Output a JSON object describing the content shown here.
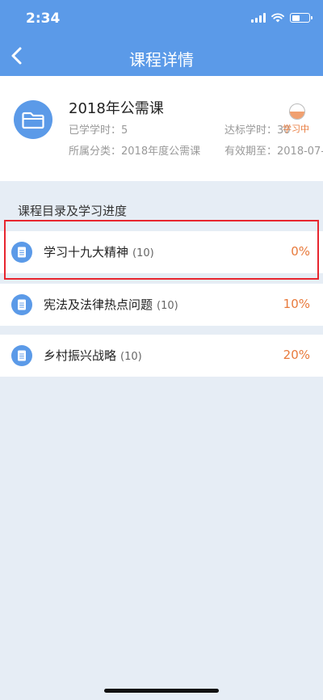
{
  "status_bar": {
    "time": "2:34"
  },
  "nav": {
    "title": "课程详情"
  },
  "course": {
    "name": "2018年公需课",
    "learned_hours": "已学学时：5",
    "target_hours": "达标学时：30",
    "category": "所属分类：2018年度公需课",
    "valid_until": "有效期至：2018-07-",
    "status": "学习中"
  },
  "catalog": {
    "title": "课程目录及学习进度",
    "items": [
      {
        "title": "学习十九大精神",
        "count": "(10)",
        "progress": "0%"
      },
      {
        "title": "宪法及法律热点问题",
        "count": "(10)",
        "progress": "10%"
      },
      {
        "title": "乡村振兴战略",
        "count": "(10)",
        "progress": "20%"
      }
    ]
  },
  "colors": {
    "primary": "#5b9ae8",
    "accent": "#e87a3c",
    "highlight": "#e8262f",
    "background": "#e6edf5"
  },
  "icons": {
    "back": "chevron-left-icon",
    "course": "folder-icon",
    "chapter": "document-icon"
  }
}
